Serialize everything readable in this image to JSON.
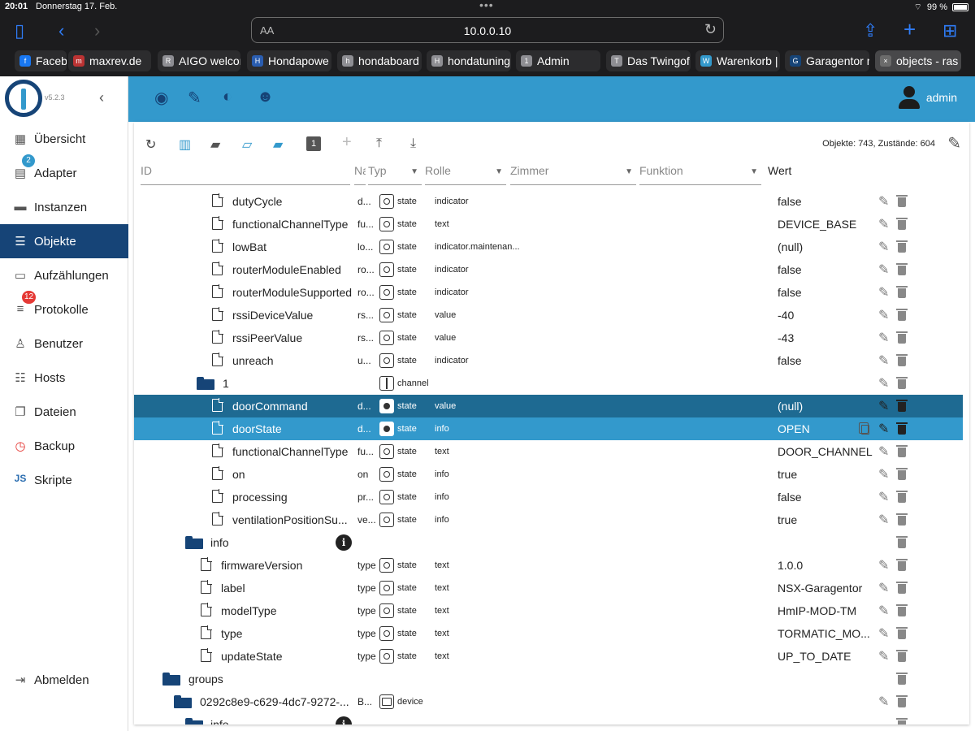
{
  "status": {
    "time": "20:01",
    "date": "Donnerstag 17. Feb.",
    "battery": "99 %"
  },
  "browser": {
    "aa": "AA",
    "url": "10.0.0.10",
    "tabs": [
      {
        "label": "Faceb",
        "fav": "f"
      },
      {
        "label": "maxrev.de",
        "fav": "m"
      },
      {
        "label": "AIGO welcor",
        "fav": "R"
      },
      {
        "label": "Hondapowe",
        "fav": "H"
      },
      {
        "label": "hondaboard",
        "fav": "h"
      },
      {
        "label": "hondatuning",
        "fav": "H"
      },
      {
        "label": "Admin",
        "fav": "1"
      },
      {
        "label": "Das Twingof",
        "fav": "T"
      },
      {
        "label": "Warenkorb |",
        "fav": "W"
      },
      {
        "label": "Garagentor r",
        "fav": "G"
      },
      {
        "label": "objects - ras",
        "fav": "×"
      }
    ]
  },
  "sidebar": {
    "version": "v5.2.3",
    "items": [
      {
        "label": "Übersicht",
        "icon": "grid-icon"
      },
      {
        "label": "Adapter",
        "icon": "store-icon",
        "badge": "2"
      },
      {
        "label": "Instanzen",
        "icon": "instances-icon"
      },
      {
        "label": "Objekte",
        "icon": "list-icon"
      },
      {
        "label": "Aufzählungen",
        "icon": "enum-icon"
      },
      {
        "label": "Protokolle",
        "icon": "log-icon",
        "badge": "12"
      },
      {
        "label": "Benutzer",
        "icon": "user-icon"
      },
      {
        "label": "Hosts",
        "icon": "hosts-icon"
      },
      {
        "label": "Dateien",
        "icon": "files-icon"
      },
      {
        "label": "Backup",
        "icon": "backup-icon"
      },
      {
        "label": "Skripte",
        "icon": "js-icon"
      }
    ],
    "logout": "Abmelden"
  },
  "header": {
    "user": "admin"
  },
  "objects": {
    "counts": "Objekte: 743, Zustände: 604",
    "columns": {
      "id": "ID",
      "name": "Na",
      "type": "Typ",
      "role": "Rolle",
      "room": "Zimmer",
      "function": "Funktion",
      "value": "Wert"
    },
    "rows": [
      {
        "name": "dutyCycle",
        "short": "d...",
        "type": "state",
        "role": "indicator",
        "value": "false"
      },
      {
        "name": "functionalChannelType",
        "short": "fu...",
        "type": "state",
        "role": "text",
        "value": "DEVICE_BASE"
      },
      {
        "name": "lowBat",
        "short": "lo...",
        "type": "state",
        "role": "indicator.maintenan...",
        "value": "(null)"
      },
      {
        "name": "routerModuleEnabled",
        "short": "ro...",
        "type": "state",
        "role": "indicator",
        "value": "false"
      },
      {
        "name": "routerModuleSupported",
        "short": "ro...",
        "type": "state",
        "role": "indicator",
        "value": "false"
      },
      {
        "name": "rssiDeviceValue",
        "short": "rs...",
        "type": "state",
        "role": "value",
        "value": "-40"
      },
      {
        "name": "rssiPeerValue",
        "short": "rs...",
        "type": "state",
        "role": "value",
        "value": "-43"
      },
      {
        "name": "unreach",
        "short": "u...",
        "type": "state",
        "role": "indicator",
        "value": "false"
      },
      {
        "name": "1",
        "short": "",
        "type": "channel",
        "role": "",
        "value": ""
      },
      {
        "name": "doorCommand",
        "short": "d...",
        "type": "state",
        "role": "value",
        "value": "(null)"
      },
      {
        "name": "doorState",
        "short": "d...",
        "type": "state",
        "role": "info",
        "value": "OPEN"
      },
      {
        "name": "functionalChannelType",
        "short": "fu...",
        "type": "state",
        "role": "text",
        "value": "DOOR_CHANNEL"
      },
      {
        "name": "on",
        "short": "on",
        "type": "state",
        "role": "info",
        "value": "true"
      },
      {
        "name": "processing",
        "short": "pr...",
        "type": "state",
        "role": "info",
        "value": "false"
      },
      {
        "name": "ventilationPositionSu...",
        "short": "ve...",
        "type": "state",
        "role": "info",
        "value": "true"
      },
      {
        "name": "info",
        "short": "",
        "type": "",
        "role": "",
        "value": ""
      },
      {
        "name": "firmwareVersion",
        "short": "type",
        "type": "state",
        "role": "text",
        "value": "1.0.0"
      },
      {
        "name": "label",
        "short": "type",
        "type": "state",
        "role": "text",
        "value": "NSX-Garagentor"
      },
      {
        "name": "modelType",
        "short": "type",
        "type": "state",
        "role": "text",
        "value": "HmIP-MOD-TM"
      },
      {
        "name": "type",
        "short": "type",
        "type": "state",
        "role": "text",
        "value": "TORMATIC_MO..."
      },
      {
        "name": "updateState",
        "short": "type",
        "type": "state",
        "role": "text",
        "value": "UP_TO_DATE"
      },
      {
        "name": "groups",
        "short": "",
        "type": "",
        "role": "",
        "value": ""
      },
      {
        "name": "0292c8e9-c629-4dc7-9272-...",
        "short": "B...",
        "type": "device",
        "role": "",
        "value": ""
      },
      {
        "name": "info",
        "short": "",
        "type": "",
        "role": "",
        "value": ""
      }
    ]
  }
}
